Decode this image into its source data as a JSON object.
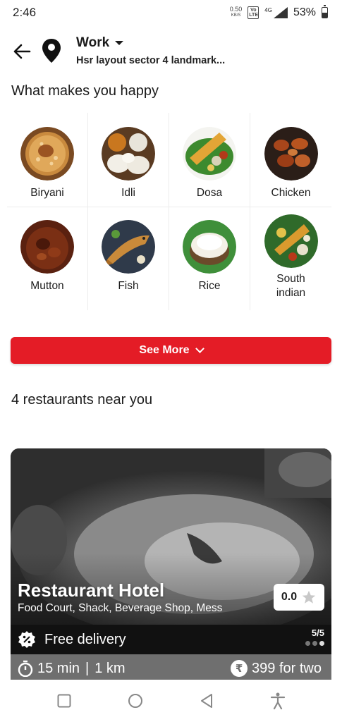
{
  "status_bar": {
    "time": "2:46",
    "net_speed_value": "0.50",
    "net_speed_unit": "KB/S",
    "volte": "Vo LTE",
    "network": "4G",
    "battery": "53%",
    "battery_level": 0.53
  },
  "header": {
    "location_title": "Work",
    "location_subtitle": "Hsr layout sector 4 landmark..."
  },
  "categories_section": {
    "title": "What makes you happy",
    "items": [
      {
        "label": "Biryani"
      },
      {
        "label": "Idli"
      },
      {
        "label": "Dosa"
      },
      {
        "label": "Chicken"
      },
      {
        "label": "Mutton"
      },
      {
        "label": "Fish"
      },
      {
        "label": "Rice"
      },
      {
        "label": "South indian"
      }
    ],
    "see_more_label": "See More"
  },
  "restaurants_section": {
    "title": "4 restaurants near you",
    "card": {
      "name": "Restaurant Hotel",
      "cuisines": "Food Court, Shack, Beverage Shop, Mess",
      "rating": "0.0",
      "offer": "Free delivery",
      "pager": "5/5",
      "time": "15 min",
      "distance": "1 km",
      "price": "399 for two",
      "rupee_symbol": "₹"
    }
  },
  "colors": {
    "accent_red": "#e41c26",
    "text": "#1c1c1c",
    "card_dark": "#111111",
    "info_bar": "#6f6f6f"
  }
}
